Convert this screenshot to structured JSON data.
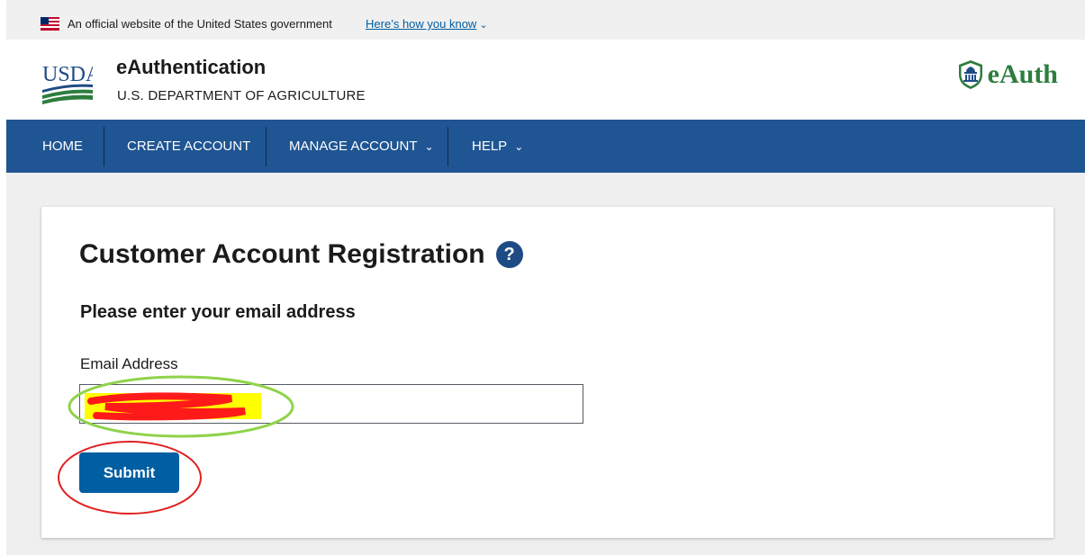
{
  "gov_banner": {
    "text": "An official website of the United States government",
    "link_label": "Here’s how you know"
  },
  "header": {
    "logo_text": "USDA",
    "app_title": "eAuthentication",
    "department": "U.S. DEPARTMENT OF AGRICULTURE",
    "eauth_logo_text": "eAuth"
  },
  "nav": {
    "items": [
      {
        "label": "HOME"
      },
      {
        "label": "CREATE ACCOUNT"
      },
      {
        "label": "MANAGE ACCOUNT"
      },
      {
        "label": "HELP"
      }
    ]
  },
  "form": {
    "title": "Customer Account Registration",
    "help_icon_glyph": "?",
    "subheading": "Please enter your email address",
    "email_label": "Email Address",
    "email_value": "",
    "submit_label": "Submit"
  },
  "colors": {
    "nav_bg": "#1f5592",
    "button_bg": "#005ea2",
    "link": "#005ea2",
    "eauth_green": "#2e7d3e"
  }
}
